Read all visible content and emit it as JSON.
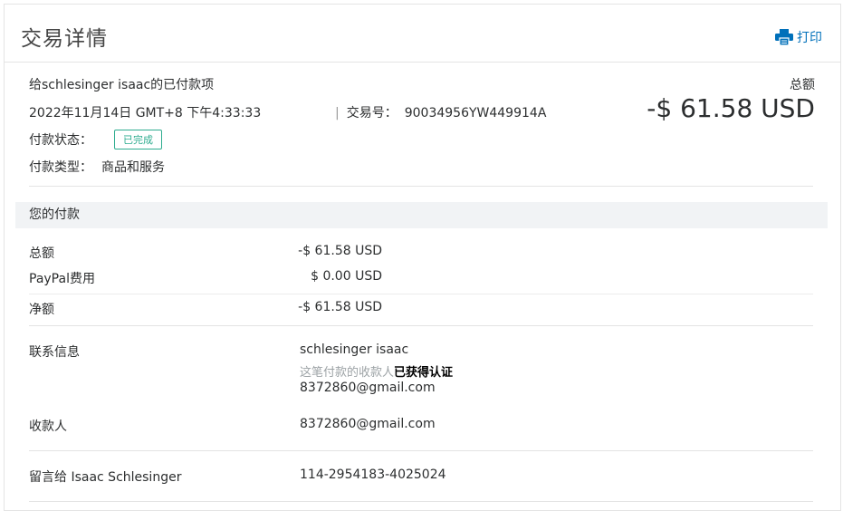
{
  "header": {
    "title": "交易详情",
    "print_label": "打印"
  },
  "summary": {
    "recipient_line": "给schlesinger isaac的已付款项",
    "datetime": "2022年11月14日 GMT+8 下午4:33:33",
    "txn_sep": "|",
    "txn_label": "交易号：",
    "txn_id": "90034956YW449914A",
    "status_label": "付款状态：",
    "status_badge": "已完成",
    "type_label": "付款类型：",
    "type_value": "商品和服务",
    "total_label": "总额",
    "total_amount": "-$ 61.58 USD"
  },
  "payment": {
    "section_title": "您的付款",
    "rows": [
      {
        "label": "总额",
        "amount": "-$ 61.58 USD"
      },
      {
        "label": "PayPal费用",
        "amount": "$ 0.00 USD"
      },
      {
        "label": "净额",
        "amount": "-$ 61.58 USD"
      }
    ]
  },
  "contact": {
    "label": "联系信息",
    "name": "schlesinger isaac",
    "verified_prefix": "这笔付款的收款人",
    "verified_status": "已获得认证",
    "email": "8372860@gmail.com"
  },
  "payee": {
    "label": "收款人",
    "email": "8372860@gmail.com"
  },
  "note": {
    "label": "留言给 Isaac Schlesinger",
    "value": "114-2954183-4025024"
  },
  "colors": {
    "accent": "#0070ba",
    "status": "#2eac8f",
    "section_bg": "#f1f3f5"
  }
}
